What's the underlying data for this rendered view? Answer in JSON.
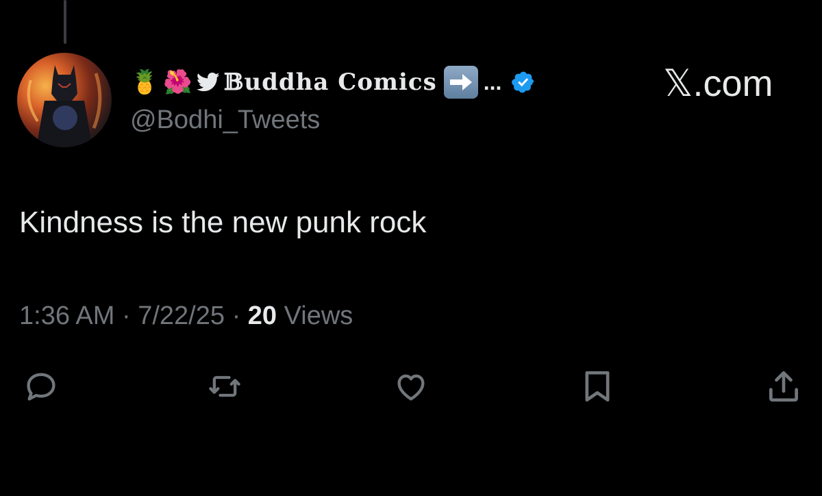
{
  "header": {
    "display_name_emojis": [
      "🍍",
      "🌺"
    ],
    "bird_icon": "twitter-bird-icon",
    "display_name": "𝔹uddha Comics",
    "arrow_icon": "right-arrow-emoji",
    "ellipsis": "...",
    "verified_icon": "verified-badge-icon",
    "handle": "@Bodhi_Tweets",
    "watermark": "𝕏.com"
  },
  "tweet": {
    "text": "Kindness is the new punk rock"
  },
  "meta": {
    "time": "1:36 AM",
    "separator": "·",
    "date": "7/22/25",
    "views_count": "20",
    "views_label": "Views"
  },
  "actions": {
    "reply_icon": "reply-icon",
    "retweet_icon": "retweet-icon",
    "like_icon": "heart-icon",
    "bookmark_icon": "bookmark-icon",
    "share_icon": "share-icon"
  },
  "colors": {
    "background": "#000000",
    "text_primary": "#e7e9ea",
    "text_secondary": "#71767b",
    "verified_blue": "#1d9bf0"
  }
}
